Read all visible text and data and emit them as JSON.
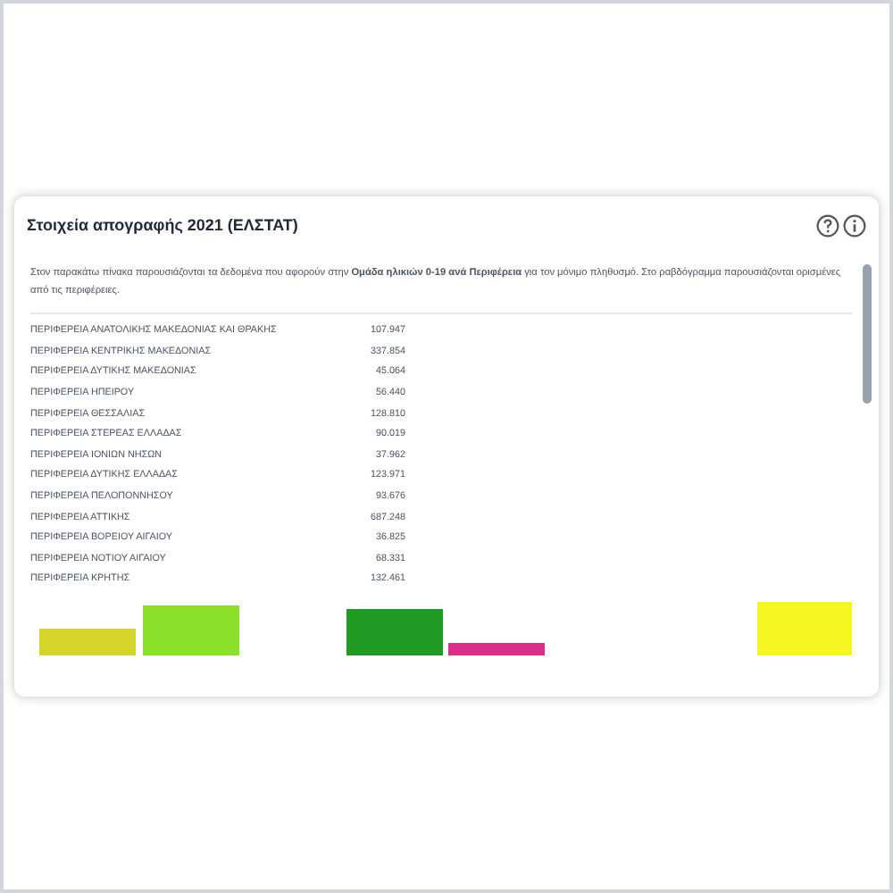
{
  "card": {
    "title": "Στοιχεία απογραφής 2021 (ΕΛΣΤΑΤ)",
    "intro": "Στον παρακάτω πίνακα παρουσιάζονται τα δεδομένα που αφορούν στην **Ομάδα ηλικιών 0-19 ανά Περιφέρεια** για τον μόνιμο πληθυσμό. Στο ραβδόγραμμα παρουσιάζονται ορισμένες από τις περιφέρειες.",
    "rows": [
      {
        "region": "ΠΕΡΙΦΕΡΕΙΑ ΑΝΑΤΟΛΙΚΗΣ ΜΑΚΕΔΟΝΙΑΣ ΚΑΙ ΘΡΑΚΗΣ",
        "value": "107.947"
      },
      {
        "region": "ΠΕΡΙΦΕΡΕΙΑ ΚΕΝΤΡΙΚΗΣ ΜΑΚΕΔΟΝΙΑΣ",
        "value": "337.854"
      },
      {
        "region": "ΠΕΡΙΦΕΡΕΙΑ ΔΥΤΙΚΗΣ ΜΑΚΕΔΟΝΙΑΣ",
        "value": "45.064"
      },
      {
        "region": "ΠΕΡΙΦΕΡΕΙΑ ΗΠΕΙΡΟΥ",
        "value": "56.440"
      },
      {
        "region": "ΠΕΡΙΦΕΡΕΙΑ ΘΕΣΣΑΛΙΑΣ",
        "value": "128.810"
      },
      {
        "region": "ΠΕΡΙΦΕΡΕΙΑ ΣΤΕΡΕΑΣ ΕΛΛΑΔΑΣ",
        "value": "90.019"
      },
      {
        "region": "ΠΕΡΙΦΕΡΕΙΑ ΙΟΝΙΩΝ ΝΗΣΩΝ",
        "value": "37.962"
      },
      {
        "region": "ΠΕΡΙΦΕΡΕΙΑ ΔΥΤΙΚΗΣ ΕΛΛΑΔΑΣ",
        "value": "123.971"
      },
      {
        "region": "ΠΕΡΙΦΕΡΕΙΑ ΠΕΛΟΠΟΝΝΗΣΟΥ",
        "value": "93.676"
      },
      {
        "region": "ΠΕΡΙΦΕΡΕΙΑ ΑΤΤΙΚΗΣ",
        "value": "687.248"
      },
      {
        "region": "ΠΕΡΙΦΕΡΕΙΑ ΒΟΡΕΙΟΥ ΑΙΓΑΙΟΥ",
        "value": "36.825"
      },
      {
        "region": "ΠΕΡΙΦΕΡΕΙΑ ΝΟΤΙΟΥ ΑΙΓΑΙΟΥ",
        "value": "68.331"
      },
      {
        "region": "ΠΕΡΙΦΕΡΕΙΑ ΚΡΗΤΗΣ",
        "value": "132.461"
      }
    ]
  }
}
